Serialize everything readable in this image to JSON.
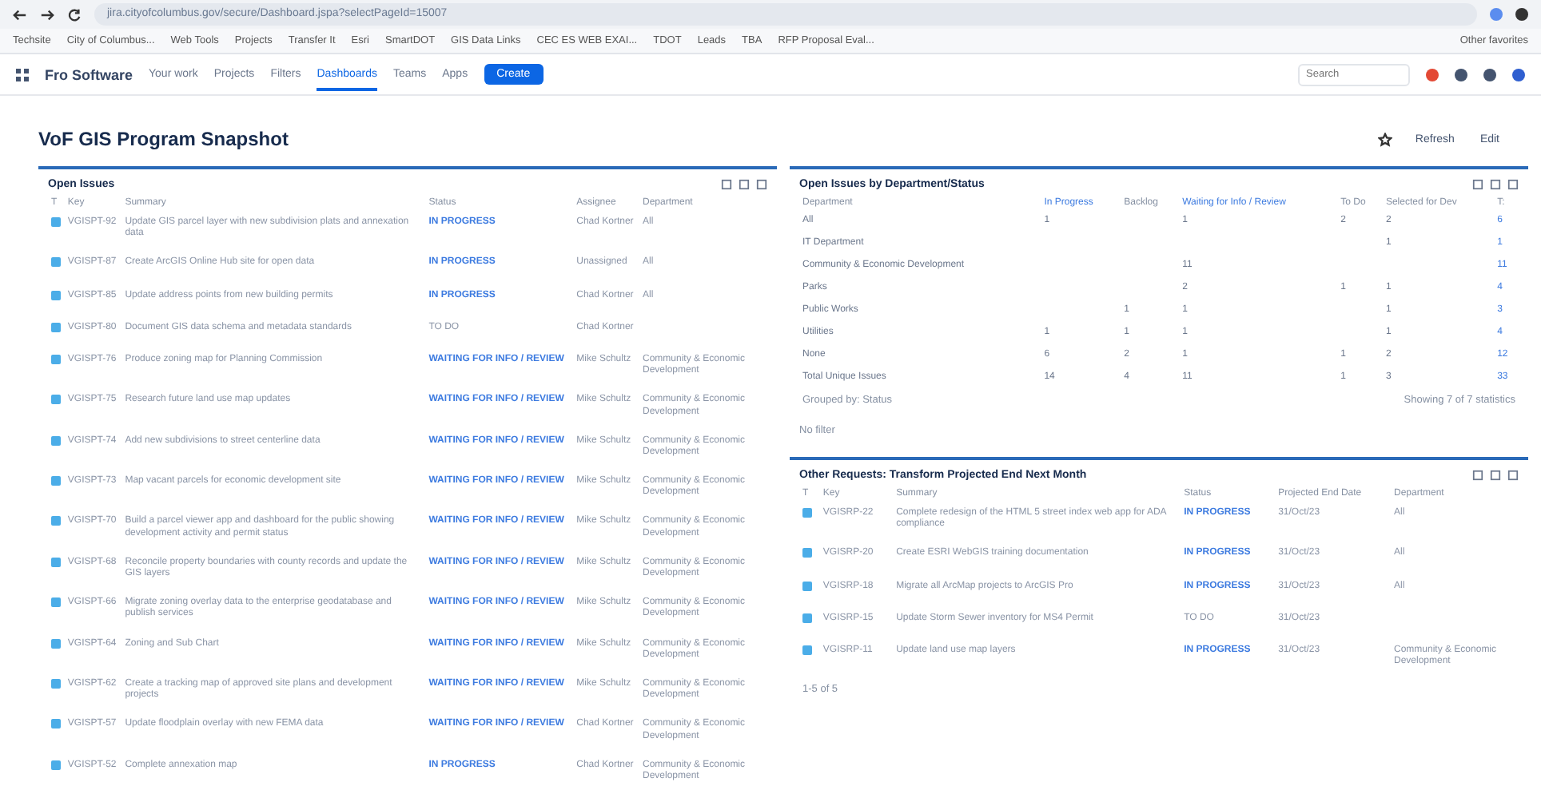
{
  "browser": {
    "url": "jira.cityofcolumbus.gov/secure/Dashboard.jspa?selectPageId=15007",
    "bookmarks": [
      "Techsite",
      "City of Columbus...",
      "Web Tools",
      "Projects",
      "Transfer It",
      "Esri",
      "SmartDOT",
      "GIS Data Links",
      "CEC ES WEB EXAI...",
      "TDOT",
      "Leads",
      "TBA",
      "RFP Proposal Eval..."
    ],
    "other_bookmarks": "Other favorites"
  },
  "nav": {
    "brand": "Fro Software",
    "items": [
      {
        "label": "Your work",
        "selected": false
      },
      {
        "label": "Projects",
        "selected": false
      },
      {
        "label": "Filters",
        "selected": false
      },
      {
        "label": "Dashboards",
        "selected": true
      },
      {
        "label": "Teams",
        "selected": false
      },
      {
        "label": "Apps",
        "selected": false
      }
    ],
    "create": "Create",
    "search": {
      "placeholder": "Search"
    }
  },
  "page": {
    "title": "VoF GIS Program Snapshot",
    "refresh": "Refresh",
    "edit": "Edit"
  },
  "open_issues": {
    "title": "Open Issues",
    "columns": [
      "T",
      "Key",
      "Summary",
      "Status",
      "Assignee",
      "Department"
    ],
    "rows": [
      {
        "key": "VGISPT-92",
        "summary": "Update GIS parcel layer with new subdivision plats and annexation data",
        "status": "IN PROGRESS",
        "kind": "link",
        "assignee": "Chad Kortner",
        "department": "All"
      },
      {
        "key": "VGISPT-87",
        "summary": "Create ArcGIS Online Hub site for open data",
        "status": "IN PROGRESS",
        "kind": "link",
        "assignee": "Unassigned",
        "department": "All"
      },
      {
        "key": "VGISPT-85",
        "summary": "Update address points from new building permits",
        "status": "IN PROGRESS",
        "kind": "link",
        "assignee": "Chad Kortner",
        "department": "All"
      },
      {
        "key": "VGISPT-80",
        "summary": "Document GIS data schema and metadata standards",
        "status": "TO DO",
        "kind": "plain",
        "assignee": "Chad Kortner"
      },
      {
        "key": "VGISPT-76",
        "summary": "Produce zoning map for Planning Commission",
        "status": "WAITING FOR INFO / REVIEW",
        "kind": "link",
        "assignee": "Mike Schultz",
        "department": "Community & Economic Development"
      },
      {
        "key": "VGISPT-75",
        "summary": "Research future land use map updates",
        "status": "WAITING FOR INFO / REVIEW",
        "kind": "link",
        "assignee": "Mike Schultz",
        "department": "Community & Economic Development"
      },
      {
        "key": "VGISPT-74",
        "summary": "Add new subdivisions to street centerline data",
        "status": "WAITING FOR INFO / REVIEW",
        "kind": "link",
        "assignee": "Mike Schultz",
        "department": "Community & Economic Development"
      },
      {
        "key": "VGISPT-73",
        "summary": "Map vacant parcels for economic development site",
        "status": "WAITING FOR INFO / REVIEW",
        "kind": "link",
        "assignee": "Mike Schultz",
        "department": "Community & Economic Development"
      },
      {
        "key": "VGISPT-70",
        "summary": "Build a parcel viewer app and dashboard for the public showing development activity and permit status",
        "status": "WAITING FOR INFO / REVIEW",
        "kind": "link",
        "assignee": "Mike Schultz",
        "department": "Community & Economic Development"
      },
      {
        "key": "VGISPT-68",
        "summary": "Reconcile property boundaries with county records and update the GIS layers",
        "status": "WAITING FOR INFO / REVIEW",
        "kind": "link",
        "assignee": "Mike Schultz",
        "department": "Community & Economic Development"
      },
      {
        "key": "VGISPT-66",
        "summary": "Migrate zoning overlay data to the enterprise geodatabase and publish services",
        "status": "WAITING FOR INFO / REVIEW",
        "kind": "link",
        "assignee": "Mike Schultz",
        "department": "Community & Economic Development"
      },
      {
        "key": "VGISPT-64",
        "summary": "Zoning and Sub Chart",
        "status": "WAITING FOR INFO / REVIEW",
        "kind": "link",
        "assignee": "Mike Schultz",
        "department": "Community & Economic Development"
      },
      {
        "key": "VGISPT-62",
        "summary": "Create a tracking map of approved site plans and development projects",
        "status": "WAITING FOR INFO / REVIEW",
        "kind": "link",
        "assignee": "Mike Schultz",
        "department": "Community & Economic Development"
      },
      {
        "key": "VGISPT-57",
        "summary": "Update floodplain overlay with new FEMA data",
        "status": "WAITING FOR INFO / REVIEW",
        "kind": "link",
        "assignee": "Chad Kortner",
        "department": "Community & Economic Development"
      },
      {
        "key": "VGISPT-52",
        "summary": "Complete annexation map",
        "status": "IN PROGRESS",
        "kind": "link",
        "assignee": "Chad Kortner",
        "department": "Community & Economic Development"
      }
    ]
  },
  "by_department": {
    "title": "Open Issues by Department/Status",
    "columns": [
      {
        "label": "Department",
        "kind": "plain"
      },
      {
        "label": "In Progress",
        "kind": "link"
      },
      {
        "label": "Backlog",
        "kind": "plain"
      },
      {
        "label": "Waiting for Info / Review",
        "kind": "link"
      },
      {
        "label": "To Do",
        "kind": "plain"
      },
      {
        "label": "Selected for Dev",
        "kind": "plain"
      },
      {
        "label": "T:",
        "kind": "plain"
      }
    ],
    "rows": [
      [
        "All",
        "1",
        "",
        "1",
        "2",
        "2",
        "6"
      ],
      [
        "IT Department",
        "",
        "",
        "",
        "",
        "1",
        "1"
      ],
      [
        "Community & Economic Development",
        "",
        "",
        "11",
        "",
        "",
        "11"
      ],
      [
        "Parks",
        "",
        "",
        "2",
        "1",
        "1",
        "4"
      ],
      [
        "Public Works",
        "",
        "1",
        "1",
        "",
        "1",
        "3"
      ],
      [
        "Utilities",
        "1",
        "1",
        "1",
        "",
        "1",
        "4"
      ],
      [
        "None",
        "6",
        "2",
        "1",
        "1",
        "2",
        "12"
      ],
      [
        "Total Unique Issues",
        "14",
        "4",
        "11",
        "1",
        "3",
        "33"
      ]
    ],
    "grouped_by": "Grouped by: Status",
    "showing": "Showing 7 of 7 statistics",
    "filter_note": "No filter"
  },
  "other_requests": {
    "title": "Other Requests: Transform Projected End Next Month",
    "columns": [
      "T",
      "Key",
      "Summary",
      "Status",
      "Projected End Date",
      "Department"
    ],
    "rows": [
      {
        "key": "VGISRP-22",
        "summary": "Complete redesign of the HTML 5 street index web app for ADA compliance",
        "status": "IN PROGRESS",
        "kind": "link",
        "date": "31/Oct/23",
        "department": "All"
      },
      {
        "key": "VGISRP-20",
        "summary": "Create ESRI WebGIS training documentation",
        "status": "IN PROGRESS",
        "kind": "link",
        "date": "31/Oct/23",
        "department": "All"
      },
      {
        "key": "VGISRP-18",
        "summary": "Migrate all ArcMap projects to ArcGIS Pro",
        "status": "IN PROGRESS",
        "kind": "link",
        "date": "31/Oct/23",
        "department": "All"
      },
      {
        "key": "VGISRP-15",
        "summary": "Update Storm Sewer inventory for MS4 Permit",
        "status": "TO DO",
        "kind": "plain",
        "date": "31/Oct/23"
      },
      {
        "key": "VGISRP-11",
        "summary": "Update land use map layers",
        "status": "IN PROGRESS",
        "kind": "link",
        "date": "31/Oct/23",
        "department": "Community & Economic Development"
      }
    ],
    "footer": "1-5 of 5"
  }
}
